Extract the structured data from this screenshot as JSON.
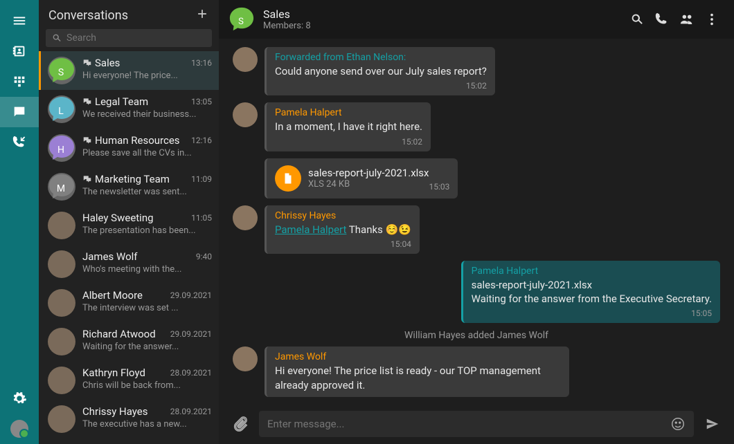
{
  "nav": {
    "items": [
      "menu",
      "contacts",
      "dialpad",
      "chat",
      "calls"
    ],
    "bottom": [
      "settings",
      "profile"
    ]
  },
  "sidebar": {
    "title": "Conversations",
    "search_placeholder": "Search",
    "conversations": [
      {
        "name": "Sales",
        "preview": "Hi everyone! The price...",
        "time": "13:16",
        "avatar_letter": "S",
        "avatar_color": "#6fbf44",
        "group": true,
        "active": true
      },
      {
        "name": "Legal Team",
        "preview": "We received their business...",
        "time": "13:05",
        "avatar_letter": "L",
        "avatar_color": "#5bb5c9",
        "group": true
      },
      {
        "name": "Human Resources",
        "preview": "Please save all the CVs in...",
        "time": "12:16",
        "avatar_letter": "H",
        "avatar_color": "#9b7fd4",
        "group": true
      },
      {
        "name": "Marketing Team",
        "preview": "The newsletter was sent...",
        "time": "11:09",
        "avatar_letter": "M",
        "avatar_color": "#808080",
        "group": true
      },
      {
        "name": "Haley Sweeting",
        "preview": "The presentation has been...",
        "time": "11:05",
        "group": false
      },
      {
        "name": "James Wolf",
        "preview": "Who's meeting with the...",
        "time": "9:40",
        "group": false
      },
      {
        "name": "Albert Moore",
        "preview": "The interview was set ...",
        "time": "29.09.2021",
        "group": false
      },
      {
        "name": "Richard Atwood",
        "preview": "Waiting for the answer...",
        "time": "29.09.2021",
        "group": false
      },
      {
        "name": "Kathryn Floyd",
        "preview": "Chris will be back from...",
        "time": "28.09.2021",
        "group": false
      },
      {
        "name": "Chrissy Hayes",
        "preview": "The executive has a new...",
        "time": "28.09.2021",
        "group": false
      }
    ]
  },
  "chat": {
    "header": {
      "title": "Sales",
      "subtitle": "Members: 8",
      "avatar_letter": "S",
      "avatar_color": "#6fbf44"
    },
    "messages": [
      {
        "kind": "msg",
        "sender": "Forwarded from Ethan Nelson:",
        "sender_style": "fwd",
        "text": "Could anyone send over our July sales report?",
        "time": "15:02",
        "show_avatar": true
      },
      {
        "kind": "msg",
        "sender": "Pamela Halpert",
        "text": "In a moment, I have it right here.",
        "time": "15:02",
        "show_avatar": true
      },
      {
        "kind": "file",
        "filename": "sales-report-july-2021.xlsx",
        "filetype": "XLS 24 KB",
        "time": "15:03"
      },
      {
        "kind": "msg",
        "sender": "Chrissy Hayes",
        "mention": "Pamela Halpert",
        "after_mention": " Thanks ☺️😉",
        "time": "15:04",
        "show_avatar": true
      },
      {
        "kind": "self",
        "sender": "Pamela Halpert",
        "line1": "sales-report-july-2021.xlsx",
        "text": "Waiting for the answer from the Executive Secretary.",
        "time": "15:05"
      },
      {
        "kind": "system",
        "text": "William Hayes added James Wolf"
      },
      {
        "kind": "msg",
        "sender": "James Wolf",
        "text": "Hi everyone! The price list is ready - our TOP management already approved it.",
        "show_avatar": true
      }
    ],
    "input_placeholder": "Enter message..."
  }
}
